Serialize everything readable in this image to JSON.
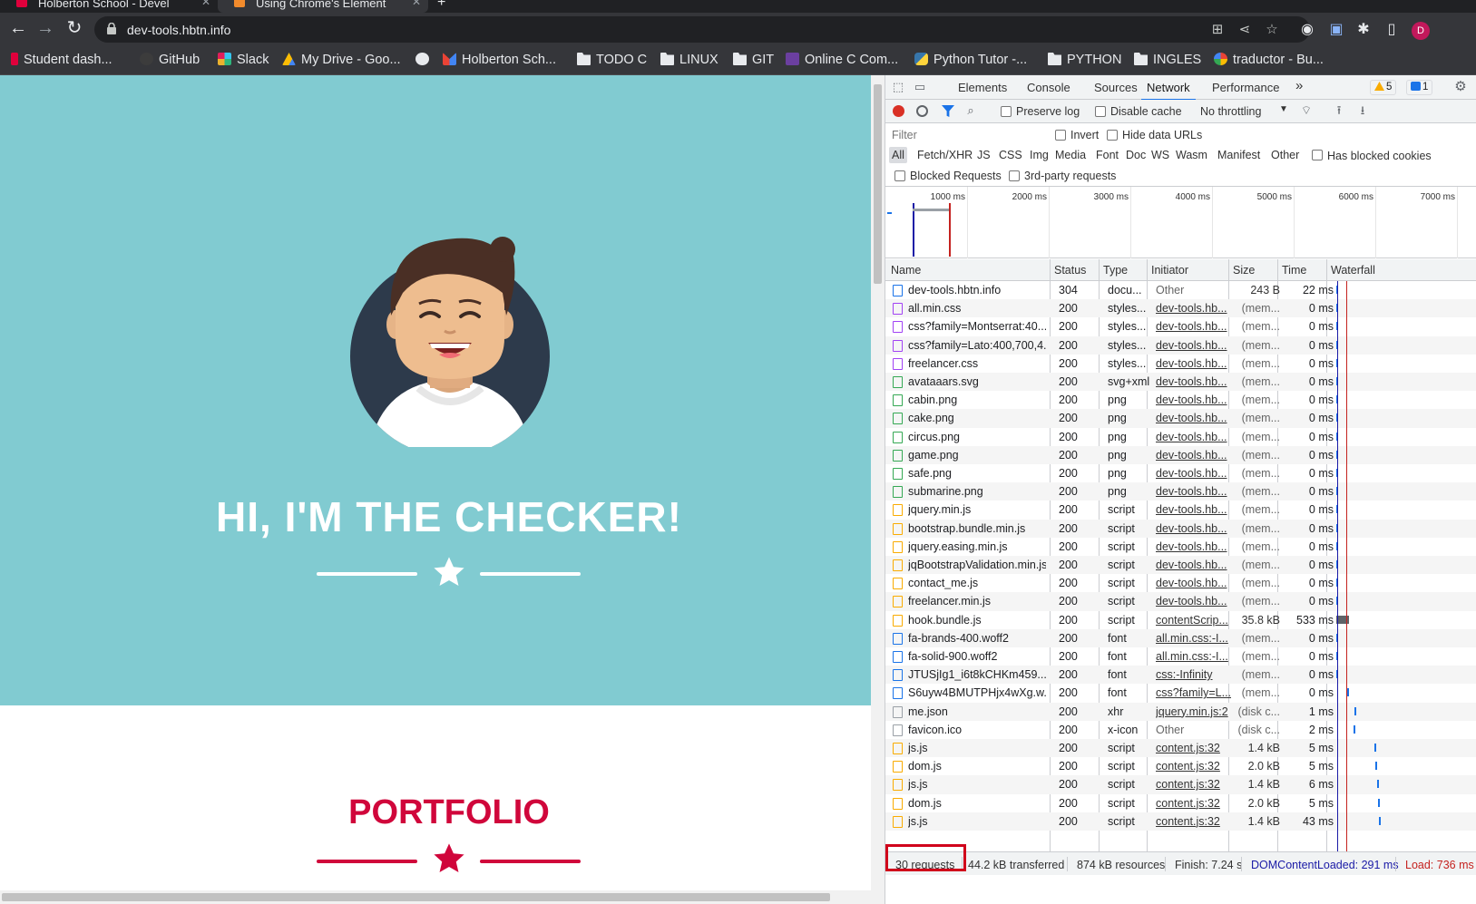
{
  "tabs": [
    {
      "title": "Holberton School - Devel",
      "active": false
    },
    {
      "title": "Using Chrome's Element",
      "active": true
    }
  ],
  "toolbar": {
    "url": "dev-tools.hbtn.info"
  },
  "bookmarks": [
    {
      "label": "Student dash...",
      "icon": "holberton-icon"
    },
    {
      "label": "GitHub",
      "icon": "github-icon"
    },
    {
      "label": "Slack",
      "icon": "slack-icon"
    },
    {
      "label": "My Drive - Goo...",
      "icon": "google-drive-icon"
    },
    {
      "label": "",
      "icon": "globe-icon"
    },
    {
      "label": "Holberton Sch...",
      "icon": "gmail-icon"
    },
    {
      "label": "TODO C",
      "icon": "folder-icon"
    },
    {
      "label": "LINUX",
      "icon": "folder-icon"
    },
    {
      "label": "GIT",
      "icon": "folder-icon"
    },
    {
      "label": "Online C Com...",
      "icon": "lightning-icon"
    },
    {
      "label": "Python Tutor -...",
      "icon": "python-icon"
    },
    {
      "label": "PYTHON",
      "icon": "folder-icon"
    },
    {
      "label": "INGLES",
      "icon": "folder-icon"
    },
    {
      "label": "traductor - Bu...",
      "icon": "google-icon"
    }
  ],
  "page": {
    "hero_title": "HI, I'M THE CHECKER!",
    "portfolio_title": "PORTFOLIO",
    "colors": {
      "hero_bg": "#81cbd1",
      "accent": "#d0063b"
    }
  },
  "devtools": {
    "tabs": [
      "Elements",
      "Console",
      "Sources",
      "Network",
      "Performance"
    ],
    "active_tab": "Network",
    "more": "»",
    "warnings": "5",
    "messages": "1",
    "toolbar": {
      "preserve_log": "Preserve log",
      "disable_cache": "Disable cache",
      "throttling": "No throttling"
    },
    "filter": {
      "placeholder": "Filter",
      "invert": "Invert",
      "hide_data_urls": "Hide data URLs",
      "types": [
        "All",
        "Fetch/XHR",
        "JS",
        "CSS",
        "Img",
        "Media",
        "Font",
        "Doc",
        "WS",
        "Wasm",
        "Manifest",
        "Other"
      ],
      "has_blocked_cookies": "Has blocked cookies",
      "blocked_requests": "Blocked Requests",
      "third_party": "3rd-party requests"
    },
    "overview_ticks": [
      "1000 ms",
      "2000 ms",
      "3000 ms",
      "4000 ms",
      "5000 ms",
      "6000 ms",
      "7000 ms"
    ],
    "columns": [
      "Name",
      "Status",
      "Type",
      "Initiator",
      "Size",
      "Time",
      "Waterfall"
    ],
    "rows": [
      {
        "name": "dev-tools.hbtn.info",
        "status": "304",
        "type": "docu...",
        "initiator": "Other",
        "size": "243 B",
        "time": "22 ms",
        "icon": "doc"
      },
      {
        "name": "all.min.css",
        "status": "200",
        "type": "styles...",
        "initiator": "dev-tools.hb...",
        "size": "(mem...",
        "time": "0 ms",
        "icon": "css"
      },
      {
        "name": "css?family=Montserrat:40...",
        "status": "200",
        "type": "styles...",
        "initiator": "dev-tools.hb...",
        "size": "(mem...",
        "time": "0 ms",
        "icon": "css"
      },
      {
        "name": "css?family=Lato:400,700,4...",
        "status": "200",
        "type": "styles...",
        "initiator": "dev-tools.hb...",
        "size": "(mem...",
        "time": "0 ms",
        "icon": "css"
      },
      {
        "name": "freelancer.css",
        "status": "200",
        "type": "styles...",
        "initiator": "dev-tools.hb...",
        "size": "(mem...",
        "time": "0 ms",
        "icon": "css"
      },
      {
        "name": "avataaars.svg",
        "status": "200",
        "type": "svg+xml",
        "initiator": "dev-tools.hb...",
        "size": "(mem...",
        "time": "0 ms",
        "icon": "img"
      },
      {
        "name": "cabin.png",
        "status": "200",
        "type": "png",
        "initiator": "dev-tools.hb...",
        "size": "(mem...",
        "time": "0 ms",
        "icon": "img"
      },
      {
        "name": "cake.png",
        "status": "200",
        "type": "png",
        "initiator": "dev-tools.hb...",
        "size": "(mem...",
        "time": "0 ms",
        "icon": "img"
      },
      {
        "name": "circus.png",
        "status": "200",
        "type": "png",
        "initiator": "dev-tools.hb...",
        "size": "(mem...",
        "time": "0 ms",
        "icon": "img"
      },
      {
        "name": "game.png",
        "status": "200",
        "type": "png",
        "initiator": "dev-tools.hb...",
        "size": "(mem...",
        "time": "0 ms",
        "icon": "img"
      },
      {
        "name": "safe.png",
        "status": "200",
        "type": "png",
        "initiator": "dev-tools.hb...",
        "size": "(mem...",
        "time": "0 ms",
        "icon": "img"
      },
      {
        "name": "submarine.png",
        "status": "200",
        "type": "png",
        "initiator": "dev-tools.hb...",
        "size": "(mem...",
        "time": "0 ms",
        "icon": "img"
      },
      {
        "name": "jquery.min.js",
        "status": "200",
        "type": "script",
        "initiator": "dev-tools.hb...",
        "size": "(mem...",
        "time": "0 ms",
        "icon": "js"
      },
      {
        "name": "bootstrap.bundle.min.js",
        "status": "200",
        "type": "script",
        "initiator": "dev-tools.hb...",
        "size": "(mem...",
        "time": "0 ms",
        "icon": "js"
      },
      {
        "name": "jquery.easing.min.js",
        "status": "200",
        "type": "script",
        "initiator": "dev-tools.hb...",
        "size": "(mem...",
        "time": "0 ms",
        "icon": "js"
      },
      {
        "name": "jqBootstrapValidation.min.js",
        "status": "200",
        "type": "script",
        "initiator": "dev-tools.hb...",
        "size": "(mem...",
        "time": "0 ms",
        "icon": "js"
      },
      {
        "name": "contact_me.js",
        "status": "200",
        "type": "script",
        "initiator": "dev-tools.hb...",
        "size": "(mem...",
        "time": "0 ms",
        "icon": "js"
      },
      {
        "name": "freelancer.min.js",
        "status": "200",
        "type": "script",
        "initiator": "dev-tools.hb...",
        "size": "(mem...",
        "time": "0 ms",
        "icon": "js"
      },
      {
        "name": "hook.bundle.js",
        "status": "200",
        "type": "script",
        "initiator": "contentScrip...",
        "size": "35.8 kB",
        "time": "533 ms",
        "icon": "js"
      },
      {
        "name": "fa-brands-400.woff2",
        "status": "200",
        "type": "font",
        "initiator": "all.min.css:-I...",
        "size": "(mem...",
        "time": "0 ms",
        "icon": "font"
      },
      {
        "name": "fa-solid-900.woff2",
        "status": "200",
        "type": "font",
        "initiator": "all.min.css:-I...",
        "size": "(mem...",
        "time": "0 ms",
        "icon": "font"
      },
      {
        "name": "JTUSjIg1_i6t8kCHKm459...",
        "status": "200",
        "type": "font",
        "initiator": "css:-Infinity",
        "size": "(mem...",
        "time": "0 ms",
        "icon": "font"
      },
      {
        "name": "S6uyw4BMUTPHjx4wXg.w...",
        "status": "200",
        "type": "font",
        "initiator": "css?family=L...",
        "size": "(mem...",
        "time": "0 ms",
        "icon": "font"
      },
      {
        "name": "me.json",
        "status": "200",
        "type": "xhr",
        "initiator": "jquery.min.js:2",
        "size": "(disk c...",
        "time": "1 ms",
        "icon": "other"
      },
      {
        "name": "favicon.ico",
        "status": "200",
        "type": "x-icon",
        "initiator": "Other",
        "size": "(disk c...",
        "time": "2 ms",
        "icon": "other"
      },
      {
        "name": "js.js",
        "status": "200",
        "type": "script",
        "initiator": "content.js:32",
        "size": "1.4 kB",
        "time": "5 ms",
        "icon": "js"
      },
      {
        "name": "dom.js",
        "status": "200",
        "type": "script",
        "initiator": "content.js:32",
        "size": "2.0 kB",
        "time": "5 ms",
        "icon": "js"
      },
      {
        "name": "js.js",
        "status": "200",
        "type": "script",
        "initiator": "content.js:32",
        "size": "1.4 kB",
        "time": "6 ms",
        "icon": "js"
      },
      {
        "name": "dom.js",
        "status": "200",
        "type": "script",
        "initiator": "content.js:32",
        "size": "2.0 kB",
        "time": "5 ms",
        "icon": "js"
      },
      {
        "name": "js.js",
        "status": "200",
        "type": "script",
        "initiator": "content.js:32",
        "size": "1.4 kB",
        "time": "43 ms",
        "icon": "js"
      }
    ],
    "summary": {
      "requests": "30 requests",
      "transferred": "44.2 kB transferred",
      "resources": "874 kB resources",
      "finish": "Finish: 7.24 s",
      "dom_content_loaded": "DOMContentLoaded: 291 ms",
      "load": "Load: 736 ms"
    }
  }
}
